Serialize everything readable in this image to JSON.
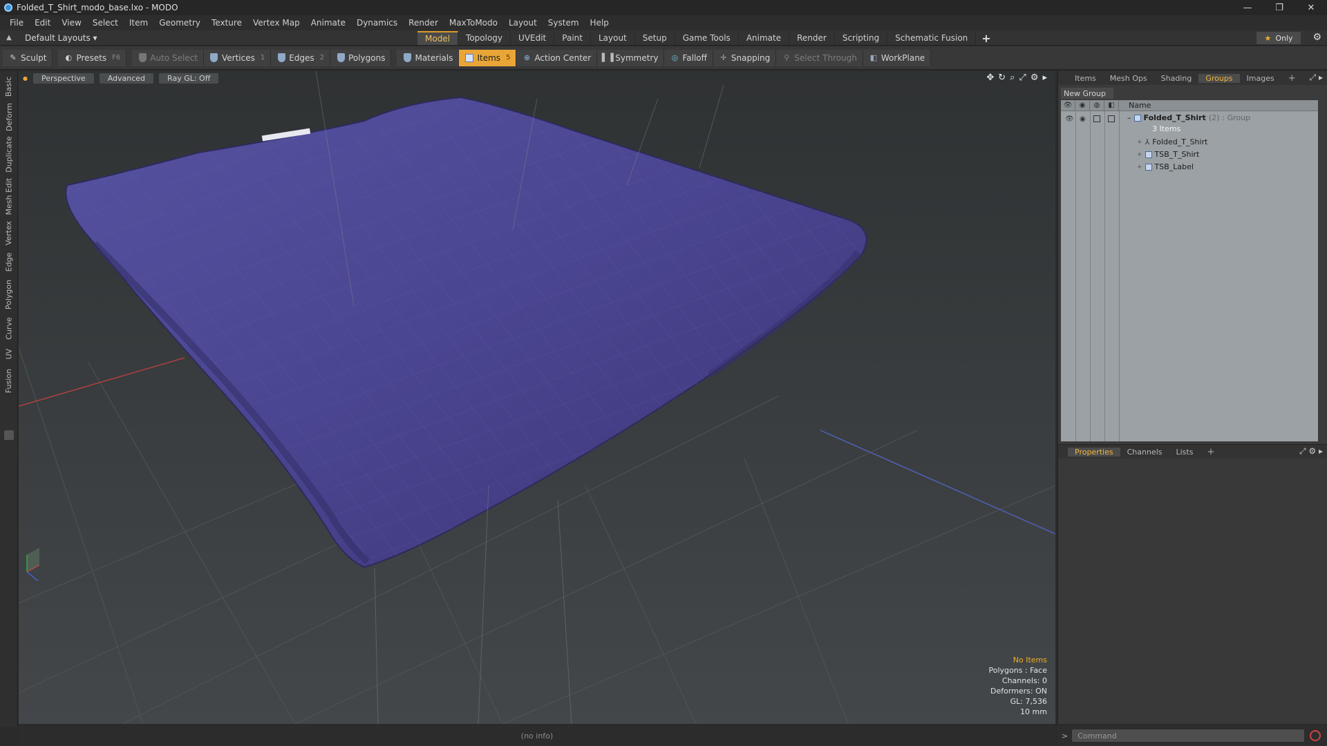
{
  "window": {
    "title": "Folded_T_Shirt_modo_base.lxo - MODO"
  },
  "menu": [
    "File",
    "Edit",
    "View",
    "Select",
    "Item",
    "Geometry",
    "Texture",
    "Vertex Map",
    "Animate",
    "Dynamics",
    "Render",
    "MaxToModo",
    "Layout",
    "System",
    "Help"
  ],
  "layouts": {
    "dropdown": "Default Layouts ▾",
    "tabs": [
      "Model",
      "Topology",
      "UVEdit",
      "Paint",
      "Layout",
      "Setup",
      "Game Tools",
      "Animate",
      "Render",
      "Scripting",
      "Schematic Fusion"
    ],
    "active": "Model",
    "only_label": "Only"
  },
  "toolbar": {
    "sculpt": "Sculpt",
    "presets": "Presets",
    "presets_key": "F6",
    "auto_select": "Auto Select",
    "vertices": "Vertices",
    "vertices_key": "1",
    "edges": "Edges",
    "edges_key": "2",
    "polygons": "Polygons",
    "materials": "Materials",
    "items": "Items",
    "items_key": "5",
    "action_center": "Action Center",
    "symmetry": "Symmetry",
    "falloff": "Falloff",
    "snapping": "Snapping",
    "select_through": "Select Through",
    "workplane": "WorkPlane"
  },
  "left_tabs": [
    "Basic",
    "Deform",
    "Duplicate",
    "Mesh Edit",
    "Vertex",
    "Edge",
    "Polygon",
    "Curve",
    "UV",
    "Fusion"
  ],
  "viewport": {
    "view": "Perspective",
    "mode": "Advanced",
    "raygl": "Ray GL: Off",
    "info": {
      "selection": "No Items",
      "polygons": "Polygons : Face",
      "channels": "Channels: 0",
      "deformers": "Deformers: ON",
      "gl": "GL: 7,536",
      "unit": "10 mm"
    },
    "status": "(no info)"
  },
  "right_panel": {
    "tabs": [
      "Items",
      "Mesh Ops",
      "Shading",
      "Groups",
      "Images"
    ],
    "active": "Groups",
    "new_group": "New Group",
    "column_name": "Name",
    "group": {
      "name": "Folded_T_Shirt",
      "count": "(2)",
      "type": ": Group",
      "items_label": "3 Items"
    },
    "children": [
      "Folded_T_Shirt",
      "TSB_T_Shirt",
      "TSB_Label"
    ]
  },
  "properties_panel": {
    "tabs": [
      "Properties",
      "Channels",
      "Lists"
    ],
    "active": "Properties"
  },
  "command": {
    "placeholder": "Command"
  },
  "colors": {
    "accent": "#e9a637",
    "mesh": "#4a4585",
    "viewport_bg": "#3a3d3e"
  }
}
